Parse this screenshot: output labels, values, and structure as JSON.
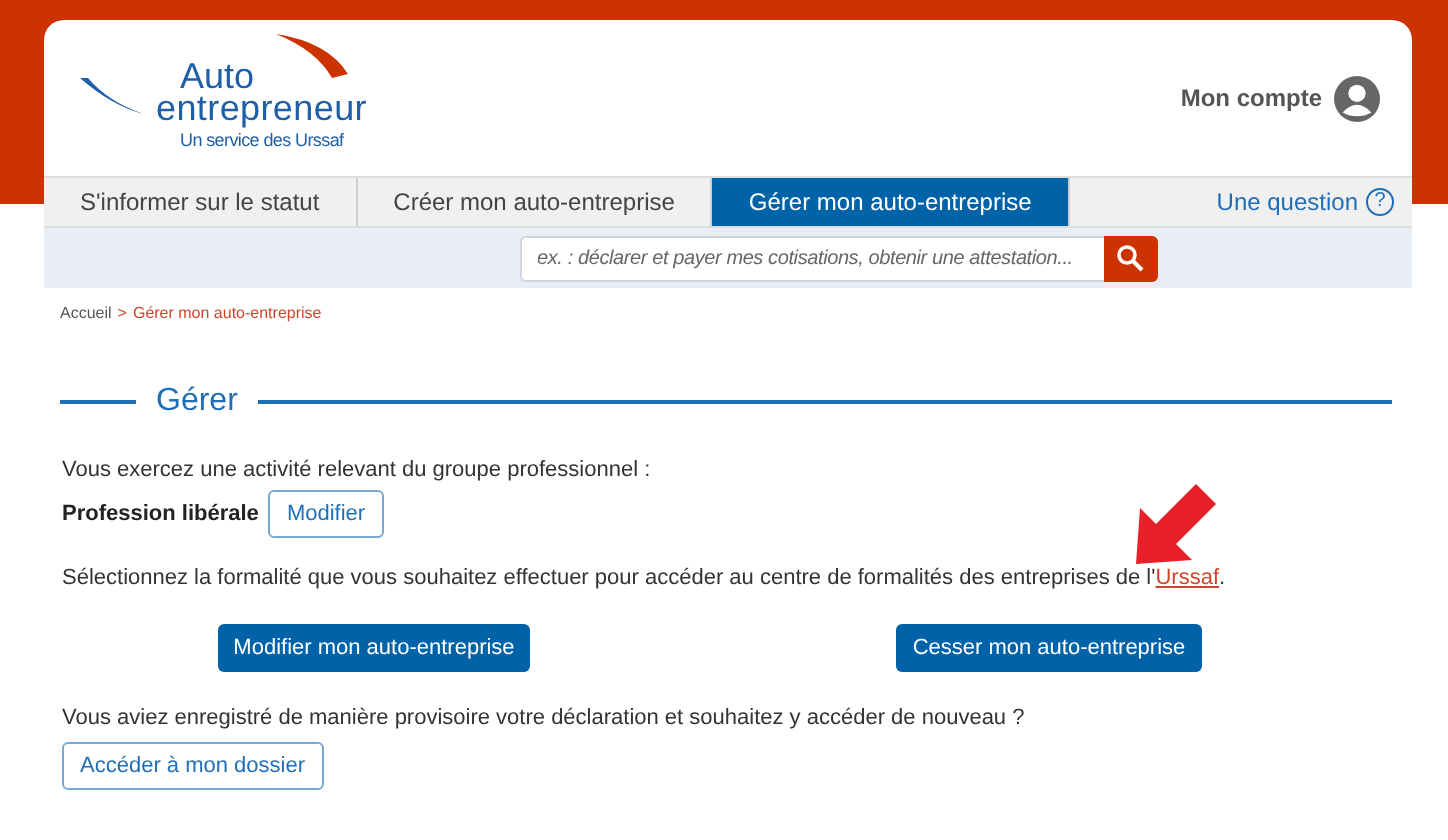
{
  "logo": {
    "line1": "Auto",
    "line2": "entrepreneur",
    "tagline": "Un service des Urssaf"
  },
  "account": {
    "label": "Mon compte"
  },
  "nav": {
    "tabs": [
      {
        "label": "S'informer sur le statut",
        "selected": false
      },
      {
        "label": "Créer mon auto-entreprise",
        "selected": false
      },
      {
        "label": "Gérer mon auto-entreprise",
        "selected": true
      }
    ],
    "help_link": "Une question",
    "help_icon": "?"
  },
  "search": {
    "placeholder": "ex. : déclarer et payer mes cotisations, obtenir une attestation..."
  },
  "breadcrumb": {
    "home": "Accueil",
    "separator": ">",
    "current": "Gérer mon auto-entreprise"
  },
  "section": {
    "title": "Gérer",
    "activity_text": "Vous exercez une activité relevant du groupe professionnel :",
    "profession": "Profession libérale",
    "modify_button": "Modifier",
    "select_text": {
      "before": "Sélectionnez la formalité que vous souhaitez effectuer pour accéder au centre de formalités des entreprises de l'",
      "link": "Urssaf",
      "after": "."
    },
    "actions": [
      "Modifier mon auto-entreprise",
      "Cesser mon auto-entreprise"
    ],
    "draft_text": "Vous aviez enregistré de manière provisoire votre déclaration et souhaitez y accéder de nouveau ?",
    "dossier_button": "Accéder à mon dossier"
  }
}
